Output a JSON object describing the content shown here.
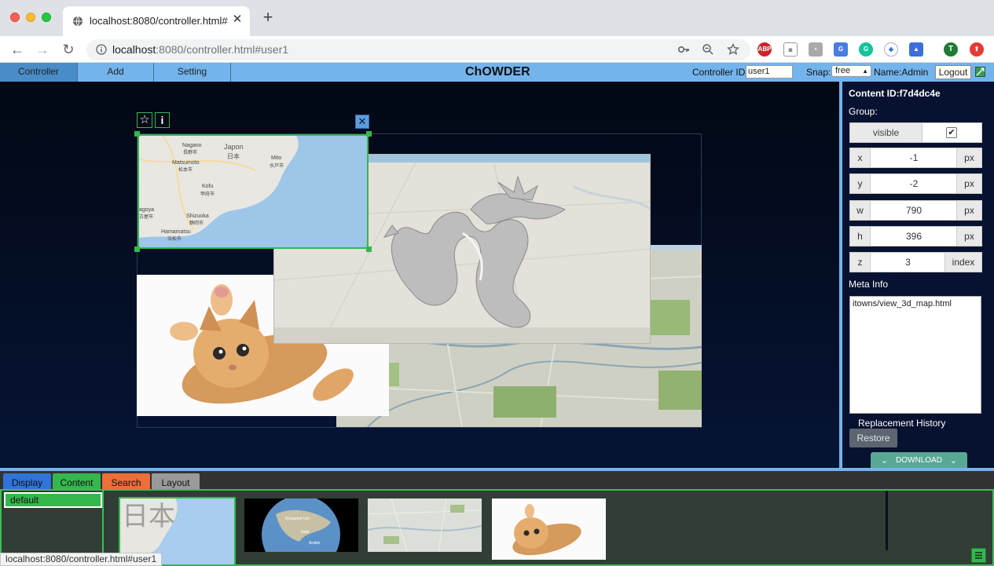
{
  "browser": {
    "tab_title": "localhost:8080/controller.html#user1",
    "tab_close": "✕",
    "new_tab": "+",
    "url_host": "localhost",
    "url_rest": ":8080/controller.html#user1",
    "extensions": [
      "ABP",
      "camera",
      "chat",
      "translate",
      "G",
      "rtc",
      "cap",
      "T",
      "up"
    ]
  },
  "header": {
    "menu": [
      {
        "label": "Controller"
      },
      {
        "label": "Add"
      },
      {
        "label": "Setting"
      }
    ],
    "title": "ChOWDER",
    "controller_id_label": "Controller ID:",
    "controller_id_value": "user1",
    "snap_label": "Snap:",
    "snap_value": "free",
    "name_label": "Name:Admin",
    "logout_label": "Logout"
  },
  "canvas": {
    "selection": {
      "star_icon": "☆",
      "info_icon": "i",
      "close_icon": "✕"
    },
    "map_labels": [
      "Nagano",
      "長野市",
      "Japon",
      "日本",
      "Matsumoto",
      "松本市",
      "Mito",
      "水戸市",
      "Kofu",
      "甲府市",
      "Shizuoka",
      "静岡市",
      "Hamamatsu",
      "浜松市",
      "agoya",
      "古屋市"
    ]
  },
  "sidebar": {
    "content_id": "Content ID:f7d4dc4e",
    "group_label": "Group:",
    "visible_label": "visible",
    "visible_checked": "✔",
    "fields": [
      {
        "label": "x",
        "value": "-1",
        "unit": "px"
      },
      {
        "label": "y",
        "value": "-2",
        "unit": "px"
      },
      {
        "label": "w",
        "value": "790",
        "unit": "px"
      },
      {
        "label": "h",
        "value": "396",
        "unit": "px"
      },
      {
        "label": "z",
        "value": "3",
        "unit": "index"
      }
    ],
    "meta_label": "Meta Info",
    "meta_value": "itowns/view_3d_map.html",
    "replacement_label": "Replacement History",
    "restore_label": "Restore",
    "download_label": "DOWNLOAD",
    "download_chevron": "≫"
  },
  "bottom": {
    "tabs": [
      {
        "label": "Display",
        "color": "#2f74d8"
      },
      {
        "label": "Content",
        "color": "#35b74d"
      },
      {
        "label": "Search",
        "color": "#ec6e3a"
      },
      {
        "label": "Layout",
        "color": "#9a9a9a"
      }
    ],
    "groups": [
      {
        "label": "default"
      }
    ],
    "thumb_text": "日本",
    "globe_labels": [
      "Royaume-Uni",
      "Italie",
      "Arabie"
    ]
  },
  "status_url": "localhost:8080/controller.html#user1",
  "colors": {
    "header_blue": "#74b4ec",
    "active_green": "#35b74d",
    "canvas_dark": "#061435"
  }
}
